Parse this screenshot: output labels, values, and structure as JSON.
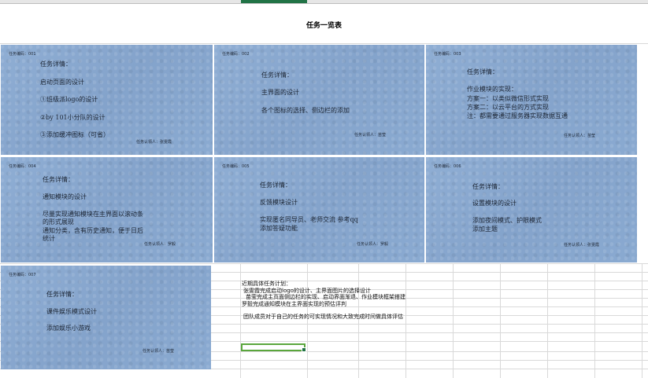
{
  "sheet": {
    "title": "任务一览表"
  },
  "cards": [
    {
      "code": "任务编码：001",
      "lines": [
        "任务详情：",
        "启动页面的设计",
        "①班级派logo的设计",
        "②by 101小分队的设计",
        "③添加缓冲图标（可省）"
      ],
      "owner": "任务认领人：张雯霞"
    },
    {
      "code": "任务编码：002",
      "lines": [
        "任务详情：",
        "主界面的设计",
        "各个图标的选择、侧边栏的添加"
      ],
      "owner": "任务认领人：苗莹"
    },
    {
      "code": "任务编码：003",
      "lines": [
        "任务详情：",
        "作业模块的实现：",
        "方案一：以类似微信形式实现",
        "方案二：以云平台的方式实现",
        "注：都需要通过服务器实现数据互通"
      ],
      "owner": "任务认领人：苗莹"
    },
    {
      "code": "任务编码：004",
      "lines": [
        "任务详情：",
        "通知模块的设计",
        "尽量实现通知模块在主界面以滚动条",
        "的形式展现",
        "通知分类，含有历史通知，便于日后",
        "统计"
      ],
      "owner": "任务认领人：罗毅"
    },
    {
      "code": "任务编码：005",
      "lines": [
        "任务详情：",
        "反馈模块设计",
        "实现匿名同导员、老师交流 参考qq",
        "添加答疑功能"
      ],
      "owner": "任务认领人：罗毅"
    },
    {
      "code": "任务编码：006",
      "lines": [
        "任务详情：",
        "设置模块的设计",
        "添加夜间模式、护眼模式",
        "添加主题"
      ],
      "owner": "任务认领人：张雯霞"
    },
    {
      "code": "任务编码：007",
      "lines": [
        "任务详情：",
        "课件娱乐模式设计",
        "添加娱乐小游戏"
      ],
      "owner": "任务认领人：苗莹"
    }
  ],
  "plan": {
    "lines": [
      "近期具体任务计划：",
      "张雯霞完成启动logo的设计、主界面图片的选择设计",
      "苗莹完成主页面侧边栏的实现、启动界面渐退、作业模块框架搭建",
      "罗毅完成通知模块在主界面实现的预估评判",
      "",
      "团队成员对于自己的任务的可实现情况和大致完成时间做具体评估"
    ]
  }
}
